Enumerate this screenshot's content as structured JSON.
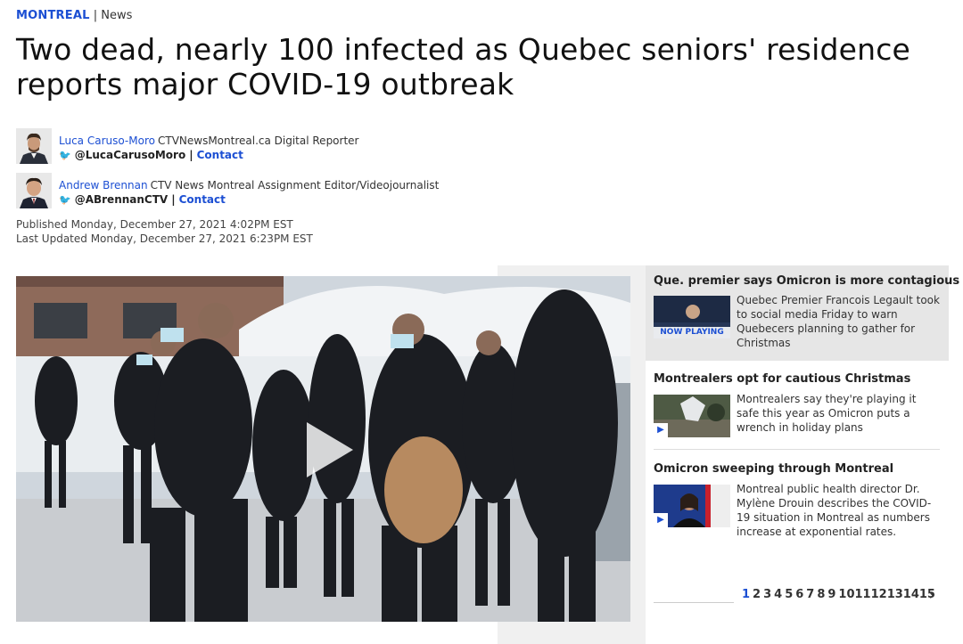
{
  "section": {
    "name": "MONTREAL",
    "separator": "|",
    "category": "News"
  },
  "headline": "Two dead, nearly 100 infected as Quebec seniors' residence reports major COVID-19 outbreak",
  "authors": [
    {
      "name": "Luca Caruso-Moro",
      "role": "CTVNewsMontreal.ca Digital Reporter",
      "handle": "@LucaCarusoMoro",
      "contact": "Contact"
    },
    {
      "name": "Andrew Brennan",
      "role": "CTV News Montreal Assignment Editor/Videojournalist",
      "handle": "@ABrennanCTV",
      "contact": "Contact"
    }
  ],
  "published": "Published Monday, December 27, 2021 4:02PM EST",
  "updated": "Last Updated Monday, December 27, 2021 6:23PM EST",
  "playlist": [
    {
      "title": "Que. premier says Omicron is more contagious",
      "description": "Quebec Premier Francois Legault took to social media Friday to warn Quebecers planning to gather for Christmas",
      "badge": "NOW PLAYING"
    },
    {
      "title": "Montrealers opt for cautious Christmas",
      "description": "Montrealers say they're playing it safe this year as Omicron puts a wrench in holiday plans"
    },
    {
      "title": "Omicron sweeping through Montreal",
      "description": "Montreal public health director Dr. Mylène Drouin describes the COVID-19 situation in Montreal as numbers increase at exponential rates."
    }
  ],
  "pagination": {
    "pages": [
      "1",
      "2",
      "3",
      "4",
      "5",
      "6",
      "7",
      "8",
      "9",
      "10",
      "11",
      "12",
      "13",
      "14",
      "15"
    ],
    "current": "1",
    "next": "›"
  },
  "colors": {
    "link": "#1c4fd3",
    "active_item_bg": "#e6e6e6",
    "sidebar_gray": "#f0f0f0"
  }
}
